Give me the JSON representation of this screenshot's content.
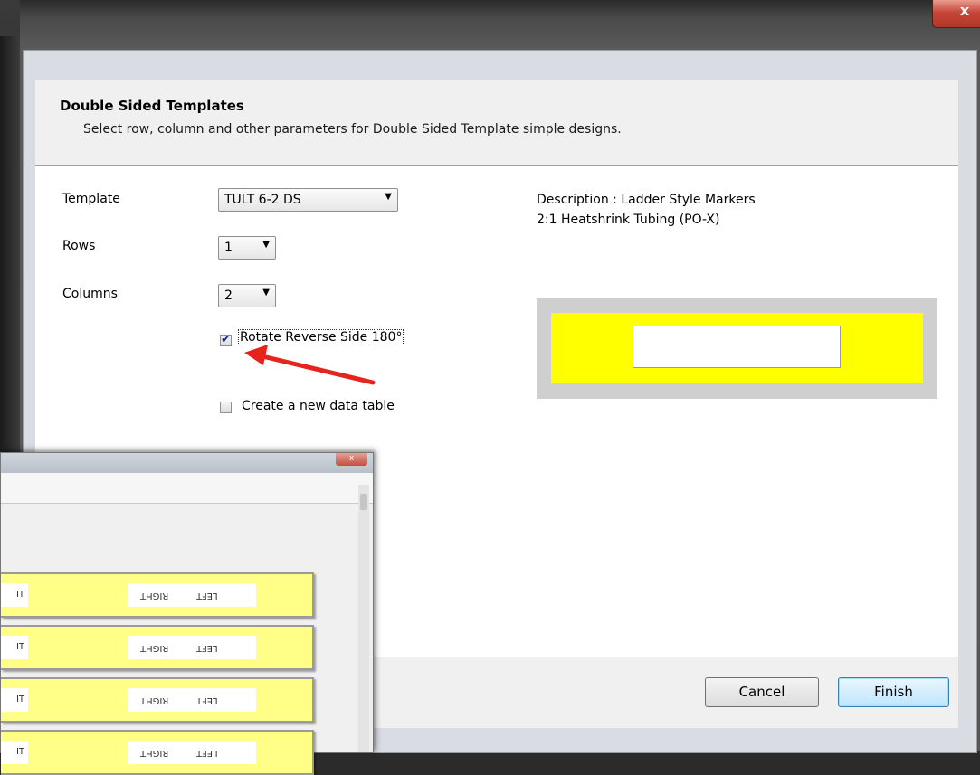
{
  "window": {
    "close_label": "x"
  },
  "header": {
    "title": "Double Sided Templates",
    "subtitle": "Select row, column and other parameters for Double Sided Template simple designs."
  },
  "form": {
    "template_label": "Template",
    "template_value": "TULT  6-2 DS",
    "rows_label": "Rows",
    "rows_value": "1",
    "columns_label": "Columns",
    "columns_value": "2",
    "rotate_label": "Rotate Reverse Side 180°",
    "rotate_checked": true,
    "new_table_label": "Create a new data table",
    "new_table_checked": false
  },
  "description": {
    "line1": "Description :  Ladder Style Markers",
    "line2": "2:1 Heatshrink Tubing (PO-X)"
  },
  "preview": {
    "label_color": "#ffff00",
    "border_color": "#cfcfcf"
  },
  "footer": {
    "cancel_label": "Cancel",
    "finish_label": "Finish"
  },
  "annotation": {
    "arrow_color": "#e8221c"
  },
  "overlay": {
    "close_label": "x",
    "strips": [
      {
        "left_text": "IT",
        "right_text_1": "RIGHT",
        "right_text_2": "LEFT"
      },
      {
        "left_text": "IT",
        "right_text_1": "RIGHT",
        "right_text_2": "LEFT"
      },
      {
        "left_text": "IT",
        "right_text_1": "RIGHT",
        "right_text_2": "LEFT"
      },
      {
        "left_text": "IT",
        "right_text_1": "RIGHT",
        "right_text_2": "LEFT"
      }
    ]
  }
}
